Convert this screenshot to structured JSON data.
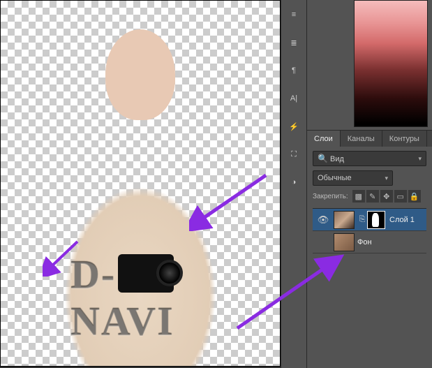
{
  "watermark_text": "D-NAVI",
  "tools": [
    {
      "name": "align-distribute-icon",
      "glyph": "≡"
    },
    {
      "name": "justify-icon",
      "glyph": "≣"
    },
    {
      "name": "paragraph-icon",
      "glyph": "¶"
    },
    {
      "name": "character-icon",
      "glyph": "A|"
    },
    {
      "name": "flash-icon",
      "glyph": "⚡",
      "green": true
    },
    {
      "name": "stamp-icon",
      "glyph": "⛶"
    },
    {
      "name": "history-icon",
      "glyph": "◑"
    }
  ],
  "panel": {
    "tabs": {
      "layers": "Слои",
      "channels": "Каналы",
      "paths": "Контуры"
    },
    "filter_label": "Вид",
    "blend_mode": "Обычные",
    "lock_label": "Закрепить:"
  },
  "layers": [
    {
      "visible": true,
      "linked": true,
      "masked": true,
      "name": "Слой 1"
    },
    {
      "visible": false,
      "linked": false,
      "masked": false,
      "name": "Фон"
    }
  ]
}
